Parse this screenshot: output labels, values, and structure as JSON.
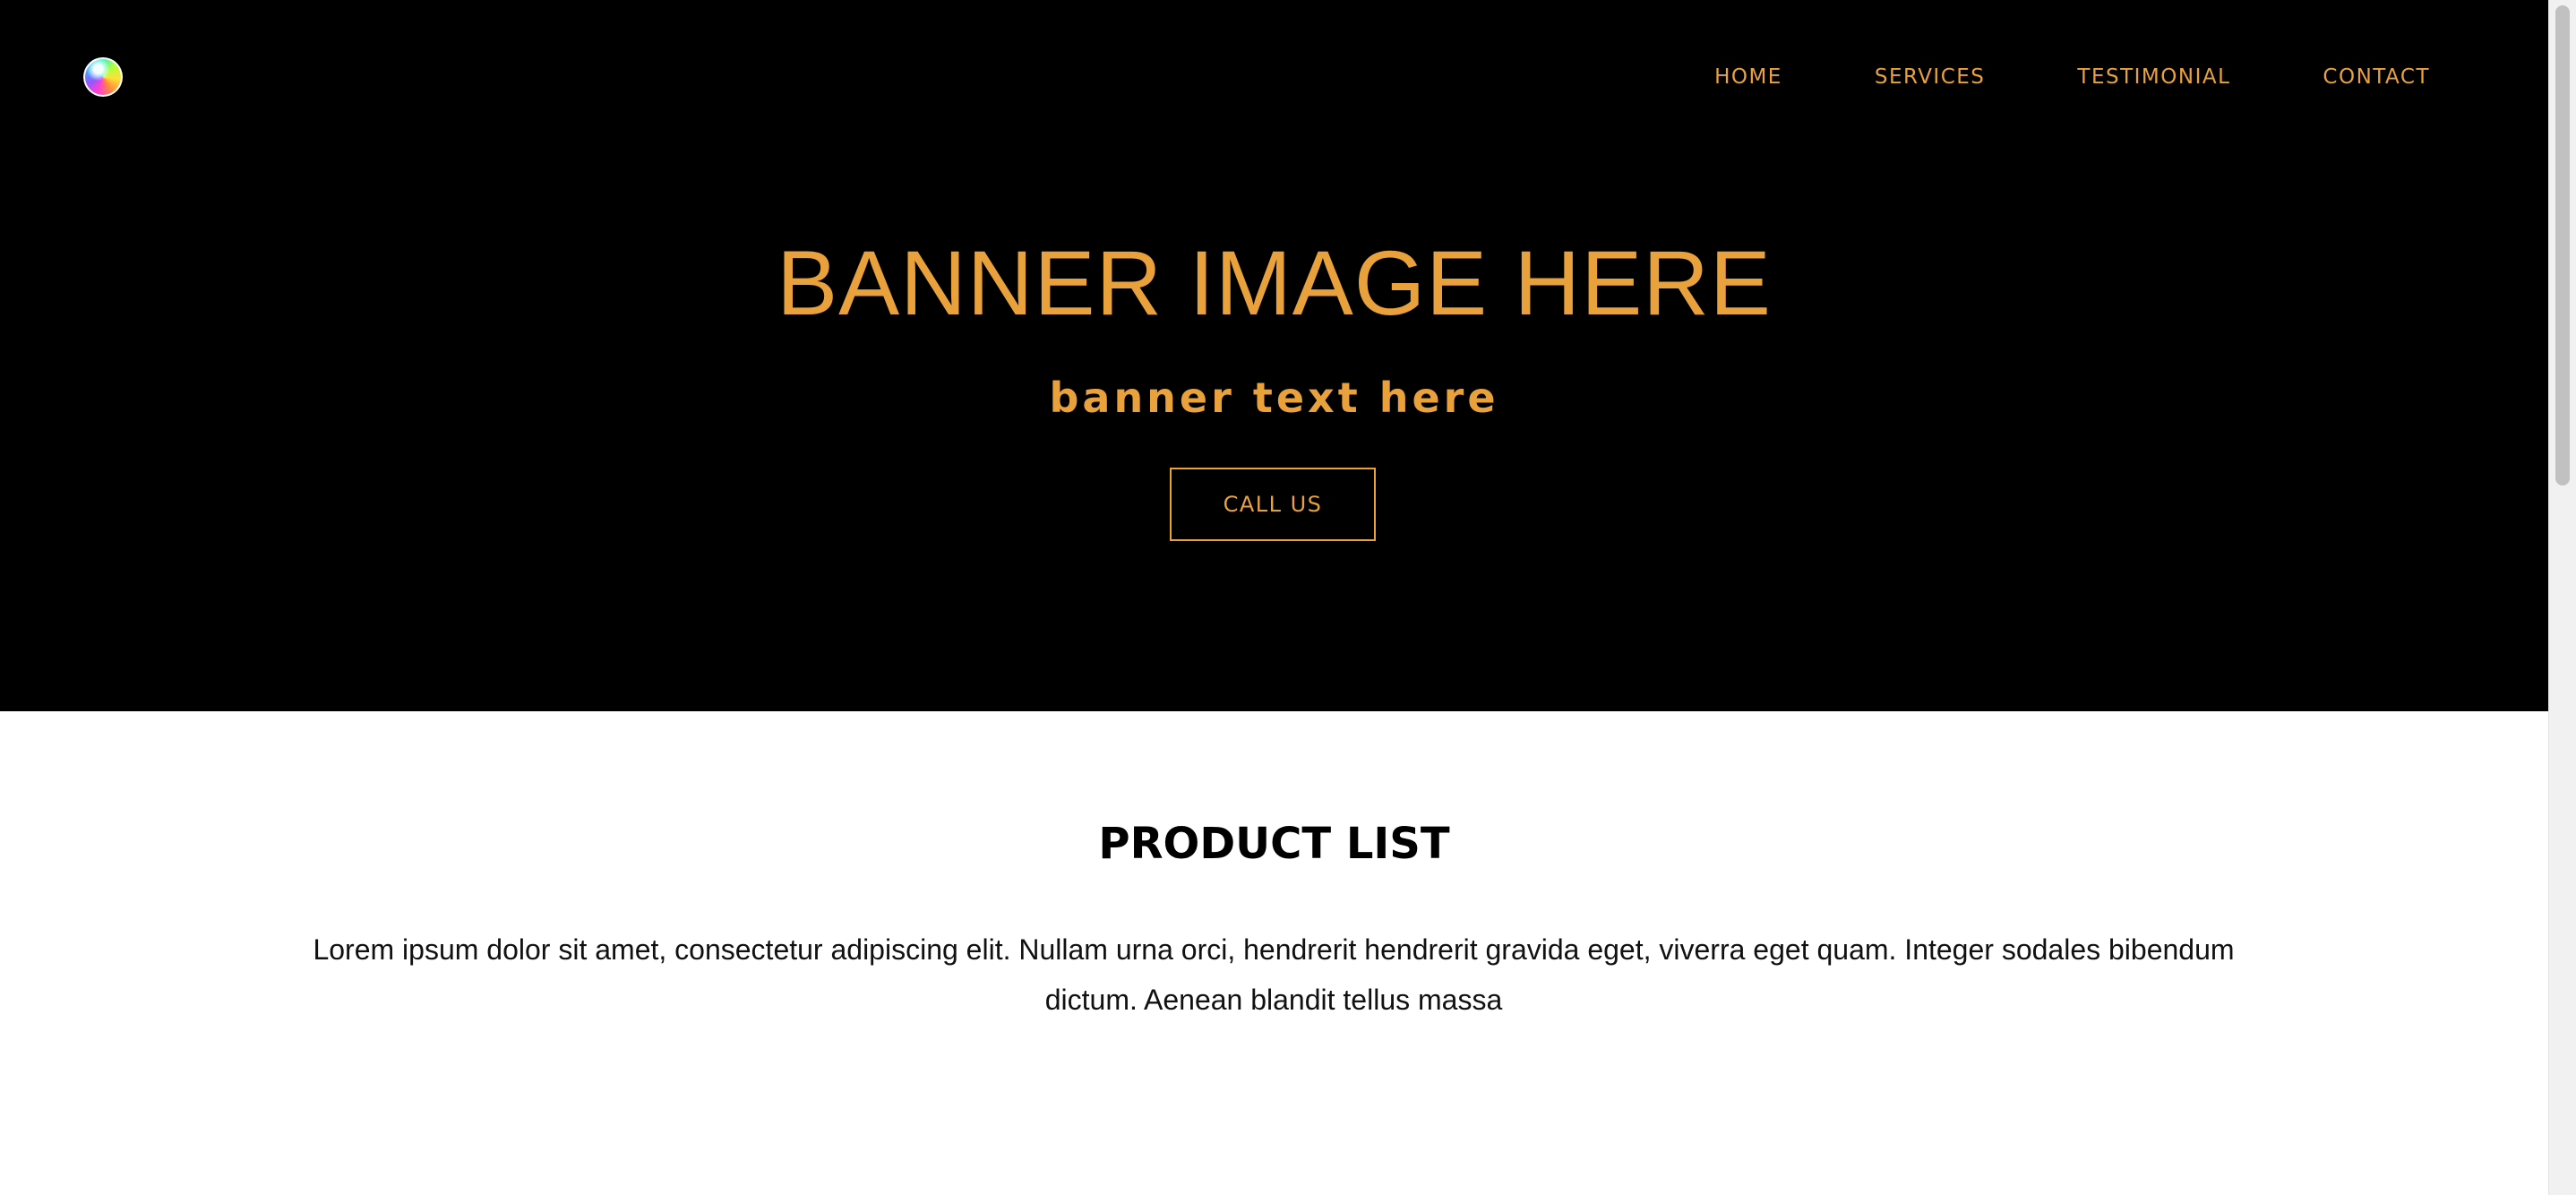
{
  "nav": {
    "logo_icon": "gradient-sphere-logo",
    "items": [
      {
        "label": "HOME"
      },
      {
        "label": "SERVICES"
      },
      {
        "label": "TESTIMONIAL"
      },
      {
        "label": "CONTACT"
      }
    ]
  },
  "hero": {
    "title": "BANNER IMAGE HERE",
    "subtitle": "banner text here",
    "cta_label": "CALL US"
  },
  "products": {
    "title": "PRODUCT LIST",
    "description": "Lorem ipsum dolor sit amet, consectetur adipiscing elit. Nullam urna orci, hendrerit hendrerit gravida eget, viverra eget quam. Integer sodales bibendum dictum. Aenean blandit tellus massa"
  },
  "colors": {
    "accent": "#e9a13b",
    "hero_background": "#000000",
    "page_background": "#ffffff",
    "text": "#000000"
  }
}
